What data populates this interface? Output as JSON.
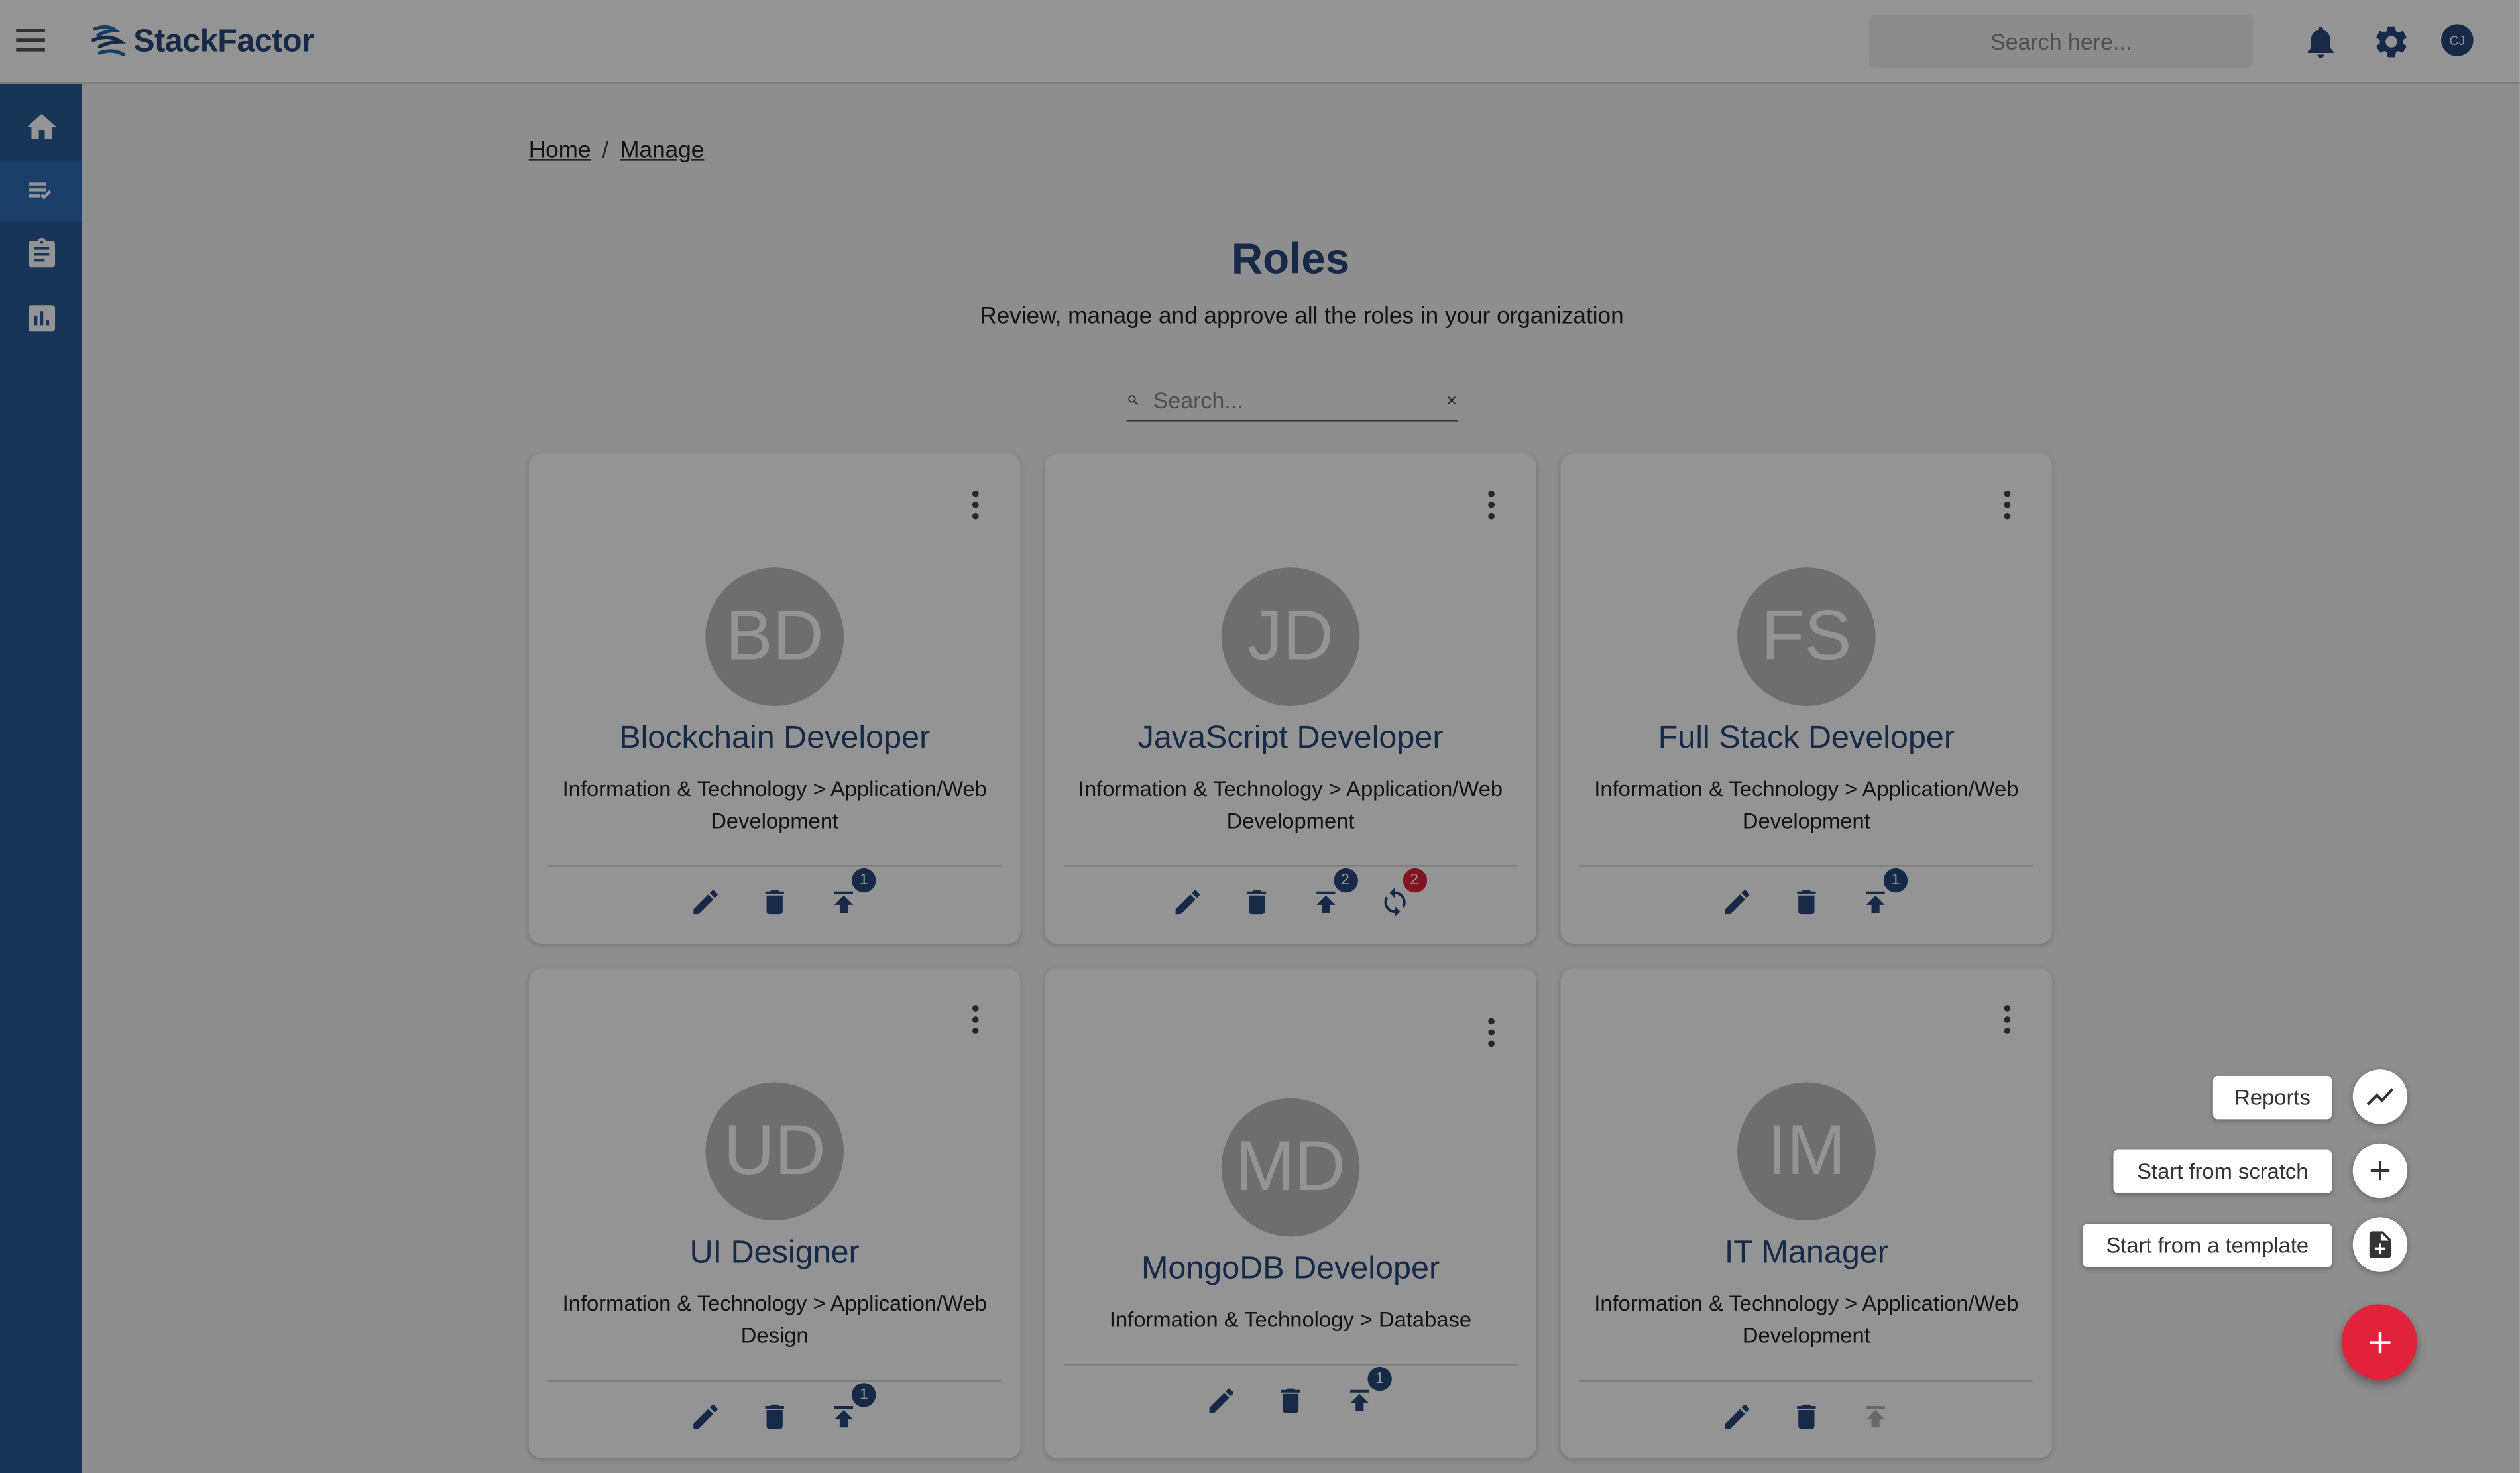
{
  "app": {
    "name": "StackFactor"
  },
  "header": {
    "search_placeholder": "Search here...",
    "user_initials": "CJ"
  },
  "sidebar": {
    "items": [
      {
        "icon": "home-icon"
      },
      {
        "icon": "checklist-icon",
        "active": true
      },
      {
        "icon": "clipboard-icon"
      },
      {
        "icon": "bar-chart-icon"
      }
    ]
  },
  "breadcrumb": {
    "home": "Home",
    "separator": "/",
    "current": "Manage"
  },
  "page": {
    "title": "Roles",
    "subtitle": "Review, manage and approve all the roles in your organization"
  },
  "roles_search": {
    "placeholder": "Search..."
  },
  "colors": {
    "brand": "#26497a",
    "sidebar": "#2a5a95",
    "badge_blue": "#26497a",
    "badge_red": "#e0223a",
    "fab": "#e0223a"
  },
  "cards": [
    {
      "initials": "BD",
      "name": "Blockchain Developer",
      "category": "Information & Technology > Application/Web Development",
      "publish_badge": "1"
    },
    {
      "initials": "JD",
      "name": "JavaScript Developer",
      "category": "Information & Technology > Application/Web Development",
      "publish_badge": "2",
      "sync_badge": "2"
    },
    {
      "initials": "FS",
      "name": "Full Stack Developer",
      "category": "Information & Technology > Application/Web Development",
      "publish_badge": "1"
    },
    {
      "initials": "UD",
      "name": "UI Designer",
      "category": "Information & Technology > Application/Web Design",
      "publish_badge": "1"
    },
    {
      "initials": "MD",
      "name": "MongoDB Developer",
      "category": "Information & Technology > Database",
      "publish_badge": "1"
    },
    {
      "initials": "IM",
      "name": "IT Manager",
      "category": "Information & Technology > Application/Web Development"
    }
  ],
  "speed_dial": {
    "reports": "Reports",
    "scratch": "Start from scratch",
    "template": "Start from a template"
  }
}
